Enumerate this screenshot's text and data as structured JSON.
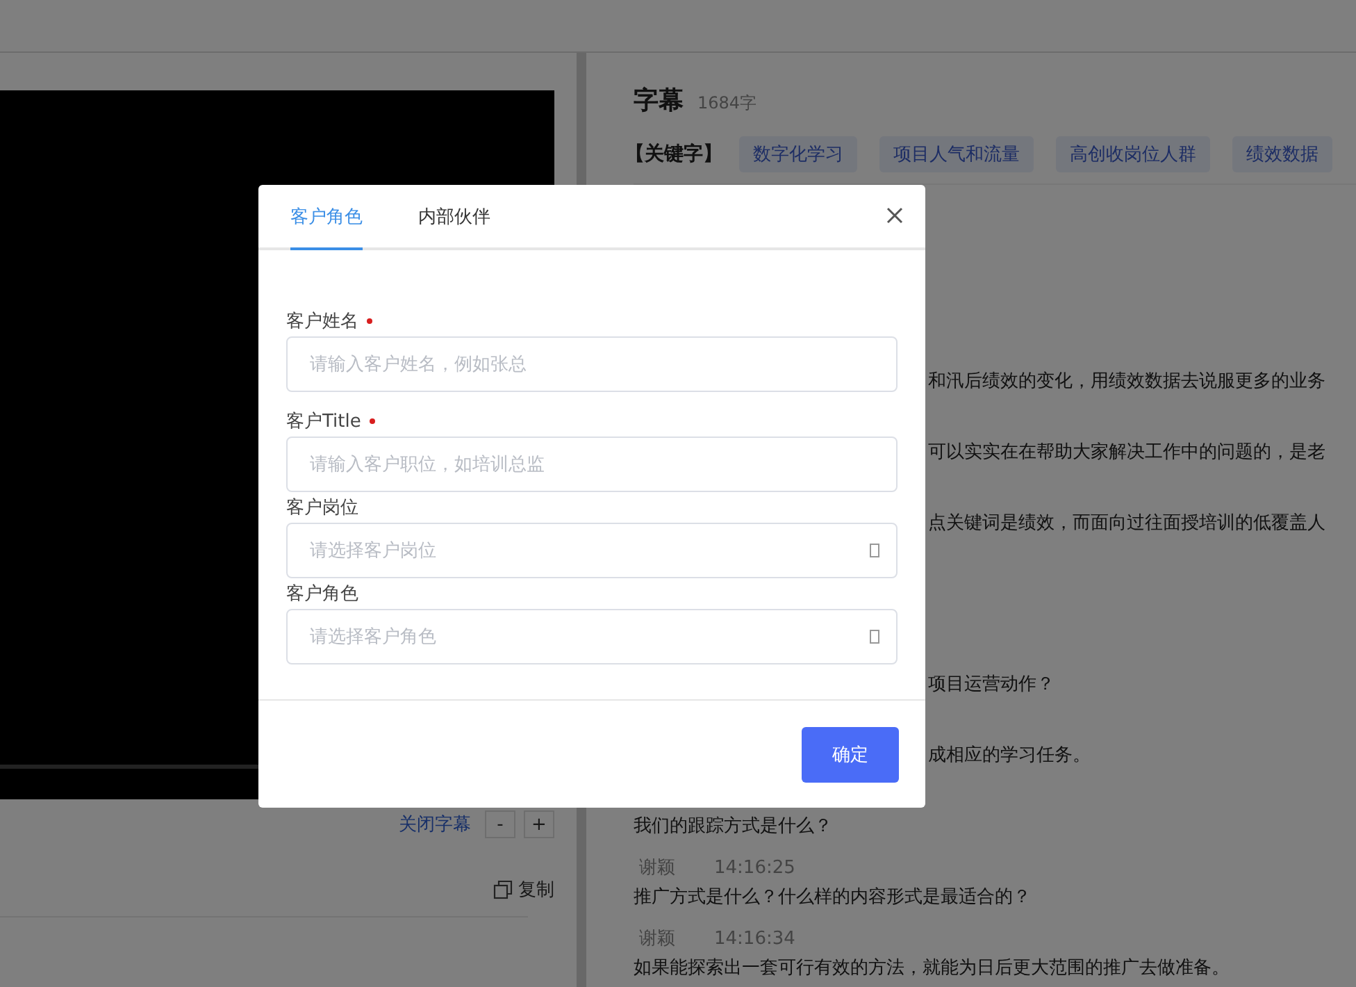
{
  "player": {
    "controls": {
      "subtitle_toggle": "关闭字幕",
      "decrease": "-",
      "increase": "+"
    },
    "copy": "复制"
  },
  "subtitles": {
    "title": "字幕",
    "count": "1684字",
    "keywords_label": "【关键字】",
    "keywords": [
      "数字化学习",
      "项目人气和流量",
      "高创收岗位人群",
      "绩效数据"
    ],
    "entries": [
      {
        "kind": "partial",
        "text": "和汛后绩效的变化，用绩效数据去说服更多的业务"
      },
      {
        "kind": "partial",
        "text": "可以实实在在帮助大家解决工作中的问题的，是老"
      },
      {
        "kind": "partial",
        "text": "点关键词是绩效，而面向过往面授培训的低覆盖人"
      },
      {
        "kind": "partial",
        "text": "项目运营动作？"
      },
      {
        "kind": "partial",
        "text": "成相应的学习任务。"
      },
      {
        "kind": "full",
        "text": "我们的跟踪方式是什么？"
      },
      {
        "kind": "full",
        "speaker": "谢颖",
        "time": "14:16:25",
        "text": "推广方式是什么？什么样的内容形式是最适合的？"
      },
      {
        "kind": "full",
        "speaker": "谢颖",
        "time": "14:16:34",
        "text": "如果能探索出一套可行有效的方法，就能为日后更大范围的推广去做准备。"
      }
    ]
  },
  "dialog": {
    "tabs": [
      {
        "label": "客户角色",
        "selected": true
      },
      {
        "label": "内部伙伴",
        "selected": false
      }
    ],
    "fields": [
      {
        "kind": "input",
        "label": "客户姓名",
        "required": true,
        "placeholder": "请输入客户姓名，例如张总"
      },
      {
        "kind": "input",
        "label": "客户Title",
        "required": true,
        "placeholder": "请输入客户职位，如培训总监"
      },
      {
        "kind": "select",
        "label": "客户岗位",
        "required": false,
        "placeholder": "请选择客户岗位"
      },
      {
        "kind": "select",
        "label": "客户角色",
        "required": false,
        "placeholder": "请选择客户角色"
      }
    ],
    "confirm": "确定"
  }
}
